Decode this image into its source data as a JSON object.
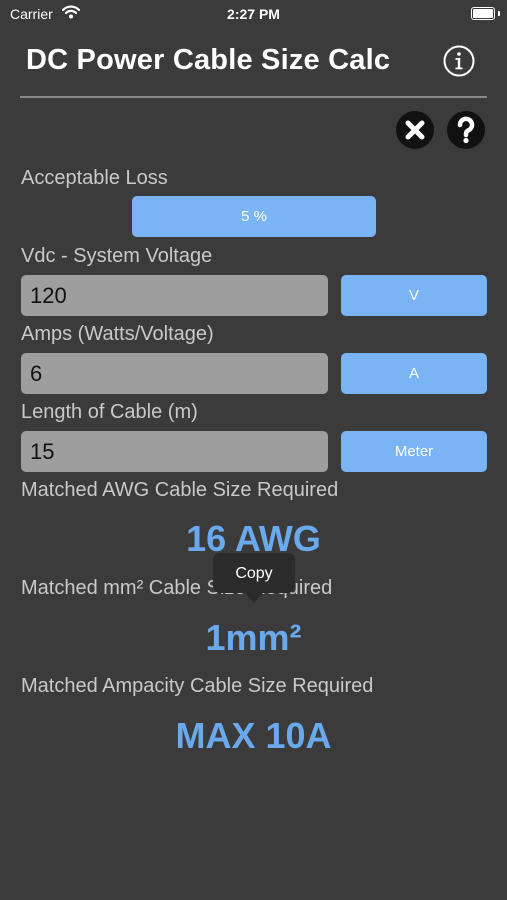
{
  "status_bar": {
    "carrier": "Carrier",
    "time": "2:27 PM"
  },
  "header": {
    "title": "DC Power Cable Size Calc"
  },
  "acceptable_loss": {
    "label": "Acceptable Loss",
    "value": "5 %"
  },
  "voltage": {
    "label": "Vdc - System Voltage",
    "value": "120",
    "unit": "V"
  },
  "amps": {
    "label": "Amps (Watts/Voltage)",
    "value": "6",
    "unit": "A"
  },
  "length": {
    "label": "Length of Cable (m)",
    "value": "15",
    "unit": "Meter"
  },
  "awg_result": {
    "label": "Matched AWG Cable Size Required",
    "value": "16 AWG"
  },
  "mm_result": {
    "label": "Matched mm² Cable Size Required",
    "value": "1mm²"
  },
  "ampacity_result": {
    "label": "Matched Ampacity Cable Size Required",
    "value": "MAX 10A"
  },
  "tooltip": {
    "label": "Copy"
  },
  "colors": {
    "background": "#3b3b3b",
    "button": "#7ab4f5",
    "result": "#6aa9ec",
    "field": "#9e9e9e"
  },
  "icons": [
    "wifi-icon",
    "battery-icon",
    "info-icon",
    "close-icon",
    "help-icon"
  ]
}
